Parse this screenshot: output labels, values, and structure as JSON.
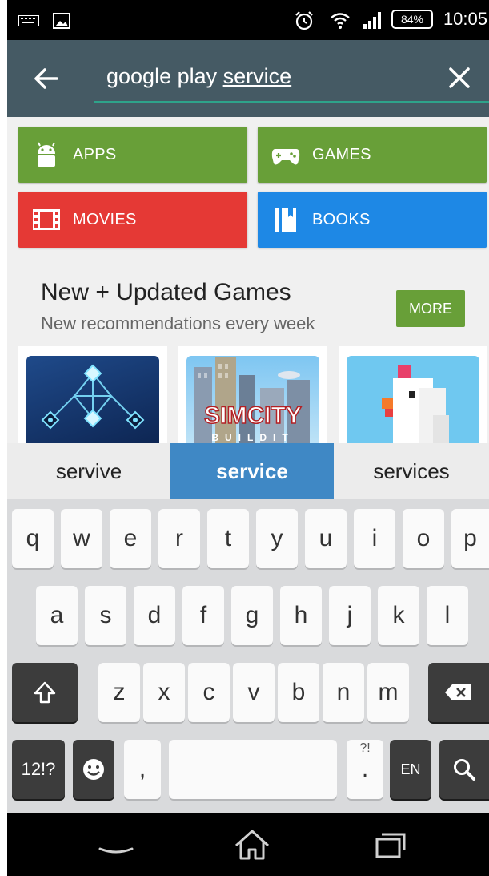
{
  "status_bar": {
    "battery": "84%",
    "time": "10:05"
  },
  "search": {
    "query_plain": "google play ",
    "query_underlined": "service"
  },
  "categories": [
    {
      "label": "APPS",
      "icon": "android-icon",
      "color": "#689f38"
    },
    {
      "label": "GAMES",
      "icon": "gamepad-icon",
      "color": "#689f38"
    },
    {
      "label": "MOVIES",
      "icon": "film-icon",
      "color": "#e53935"
    },
    {
      "label": "BOOKS",
      "icon": "book-icon",
      "color": "#1e88e5"
    }
  ],
  "section": {
    "title": "New + Updated Games",
    "subtitle": "New recommendations every week",
    "more_label": "MORE"
  },
  "games": [
    {
      "icon": "diamond-puzzle-art"
    },
    {
      "icon": "simcity-art",
      "art_text": "SIMCITY",
      "art_subtext": "BUILDIT"
    },
    {
      "icon": "pixel-chicken-art"
    }
  ],
  "suggestions": [
    "servive",
    "service",
    "services"
  ],
  "keyboard": {
    "row1": [
      "q",
      "w",
      "e",
      "r",
      "t",
      "y",
      "u",
      "i",
      "o",
      "p"
    ],
    "row2": [
      "a",
      "s",
      "d",
      "f",
      "g",
      "h",
      "j",
      "k",
      "l"
    ],
    "row3": [
      "z",
      "x",
      "c",
      "v",
      "b",
      "n",
      "m"
    ],
    "symbols_label": "12!?",
    "comma": ",",
    "period": ".",
    "period_hint": "?!",
    "language": "EN"
  }
}
